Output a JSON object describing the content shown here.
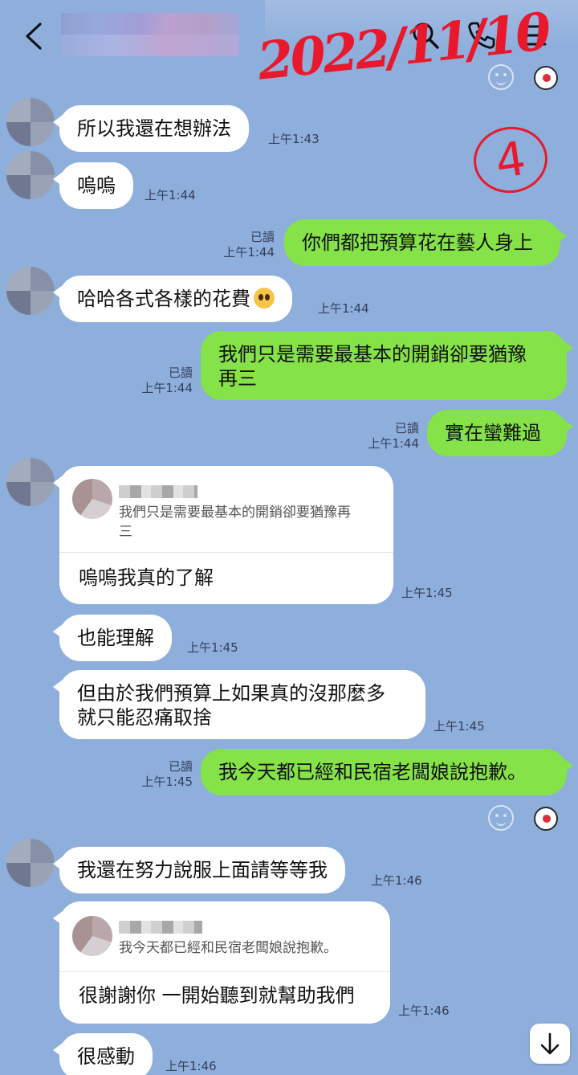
{
  "header": {
    "back_icon": "chevron-left-icon",
    "search_icon": "search-icon",
    "call_icon": "phone-icon",
    "menu_icon": "hamburger-menu-icon"
  },
  "annotation": {
    "date": "2022/11/10",
    "circled_number": "4"
  },
  "messages": [
    {
      "text": "所以我還在想辦法",
      "time": "上午1:43"
    },
    {
      "text": "嗚嗚",
      "time": "上午1:44"
    },
    {
      "text": "你們都把預算花在藝人身上",
      "read": "已讀",
      "time": "上午1:44"
    },
    {
      "text": "哈哈各式各樣的花費",
      "time": "上午1:44"
    },
    {
      "text": "我們只是需要最基本的開銷卻要猶豫\n再三",
      "read": "已讀",
      "time": "上午1:44"
    },
    {
      "text": "實在蠻難過",
      "read": "已讀",
      "time": "上午1:44"
    },
    {
      "quote": "我們只是需要最基本的開銷卻要猶豫再\n三",
      "text": "嗚嗚我真的了解",
      "time": "上午1:45"
    },
    {
      "text": "也能理解",
      "time": "上午1:45"
    },
    {
      "text": "但由於我們預算上如果真的沒那麼多\n就只能忍痛取捨",
      "time": "上午1:45"
    },
    {
      "text": "我今天都已經和民宿老闆娘說抱歉。",
      "read": "已讀",
      "time": "上午1:45"
    },
    {
      "text": "我還在努力說服上面請等等我",
      "time": "上午1:46"
    },
    {
      "quote": "我今天都已經和民宿老闆娘說抱歉。",
      "text": "很謝謝你 一開始聽到就幫助我們",
      "time": "上午1:46"
    },
    {
      "text": "很感動",
      "time": "上午1:46"
    }
  ],
  "colors": {
    "background": "#8eaedc",
    "outgoing": "#85e249",
    "incoming": "#ffffff",
    "annotation": "#e8192c"
  },
  "scroll_icon": "arrow-down-icon"
}
